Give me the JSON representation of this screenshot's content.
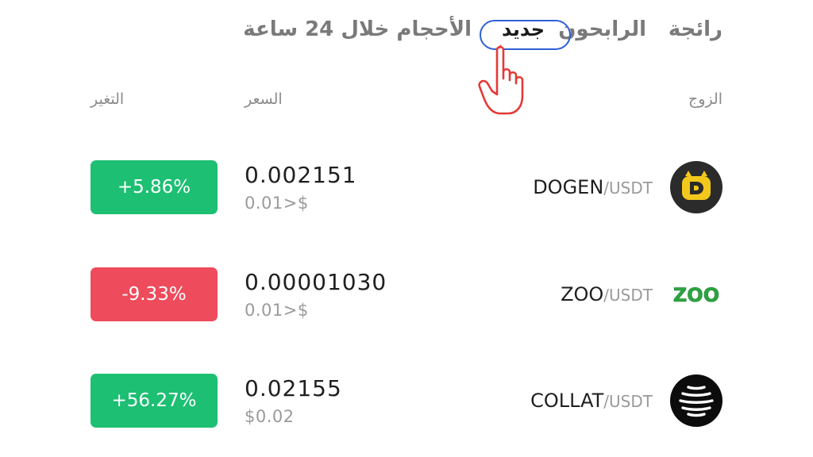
{
  "tabs": [
    {
      "label": "رائجة",
      "active": false
    },
    {
      "label": "الرابحون",
      "active": false
    },
    {
      "label": "جديد",
      "active": true
    },
    {
      "label": "الأحجام خلال 24 ساعة",
      "active": false
    }
  ],
  "columns": {
    "pair": "الزوج",
    "price": "السعر",
    "change": "التغير"
  },
  "rows": [
    {
      "base": "DOGEN",
      "quote": "/USDT",
      "price": "0.002151",
      "sub_price": "0.01>$",
      "change": "+5.86%",
      "trend": "up",
      "icon": "dogen-logo-icon"
    },
    {
      "base": "ZOO",
      "quote": "/USDT",
      "price": "0.00001030",
      "sub_price": "0.01>$",
      "change": "-9.33%",
      "trend": "down",
      "icon": "zoo-logo-icon",
      "icon_text": "ZOO"
    },
    {
      "base": "COLLAT",
      "quote": "/USDT",
      "price": "0.02155",
      "sub_price": "$0.02",
      "change": "+56.27%",
      "trend": "up",
      "icon": "collat-logo-icon"
    }
  ],
  "colors": {
    "up": "#1dbf73",
    "down": "#ee4b5c",
    "highlight": "#2f5fd8",
    "pointer": "#e53935"
  }
}
